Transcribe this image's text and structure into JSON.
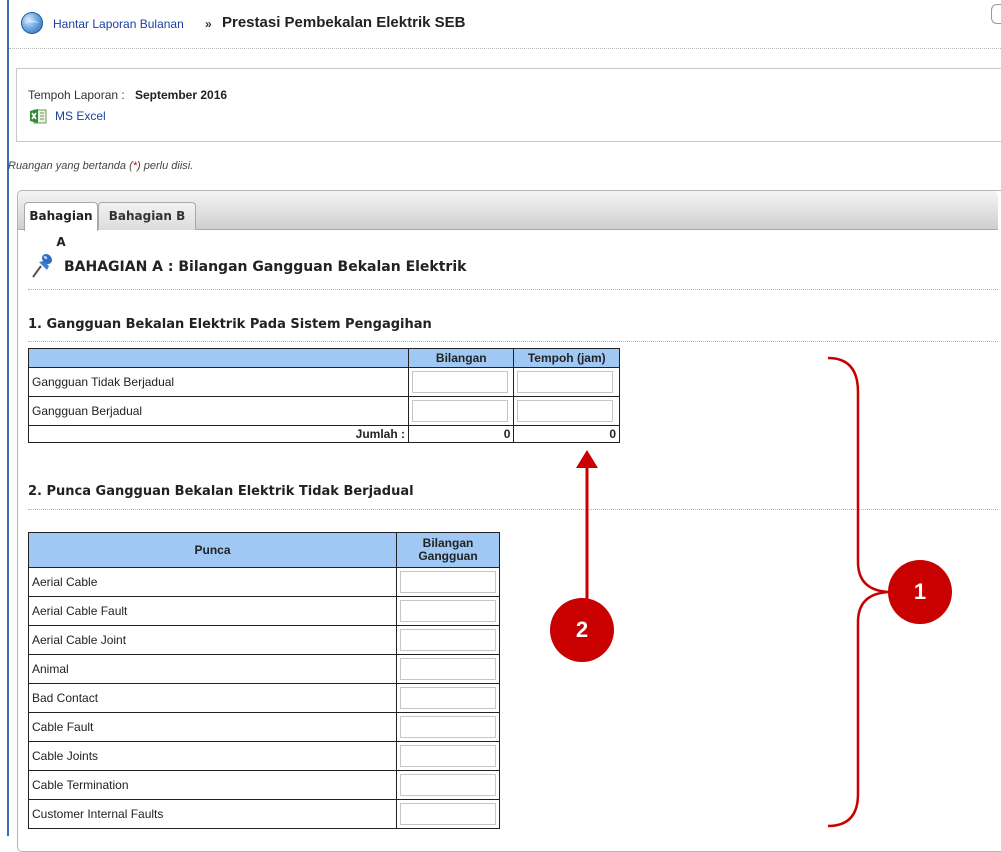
{
  "header": {
    "breadcrumb_link": "Hantar Laporan Bulanan",
    "separator": "»",
    "title": "Prestasi Pembekalan Elektrik SEB"
  },
  "info": {
    "period_label": "Tempoh Laporan :",
    "period_value": "September 2016",
    "excel_link": "MS Excel"
  },
  "required_note": {
    "before": "Ruangan yang bertanda (",
    "star": "*",
    "after": ") perlu diisi."
  },
  "tabs": [
    {
      "label": "Bahagian A",
      "active": true
    },
    {
      "label": "Bahagian B",
      "active": false
    }
  ],
  "section": {
    "title": "BAHAGIAN A : Bilangan Gangguan Bekalan Elektrik"
  },
  "q1": {
    "title": "1. Gangguan Bekalan Elektrik Pada Sistem Pengagihan",
    "columns": [
      "",
      "Bilangan",
      "Tempoh (jam)"
    ],
    "rows": [
      "Gangguan Tidak Berjadual",
      "Gangguan Berjadual"
    ],
    "total_label": "Jumlah :",
    "total_bilangan": "0",
    "total_tempoh": "0"
  },
  "q2": {
    "title": "2. Punca Gangguan Bekalan Elektrik Tidak Berjadual",
    "columns": [
      "Punca",
      "Bilangan Gangguan"
    ],
    "rows": [
      "Aerial Cable",
      "Aerial Cable Fault",
      "Aerial Cable Joint",
      "Animal",
      "Bad Contact",
      "Cable Fault",
      "Cable Joints",
      "Cable Termination",
      "Customer Internal Faults"
    ]
  },
  "annotations": {
    "badge_1": "1",
    "badge_2": "2",
    "color": "#c80000"
  },
  "colors": {
    "table_header": "#9fc8f4",
    "link": "#1a3fa0"
  }
}
